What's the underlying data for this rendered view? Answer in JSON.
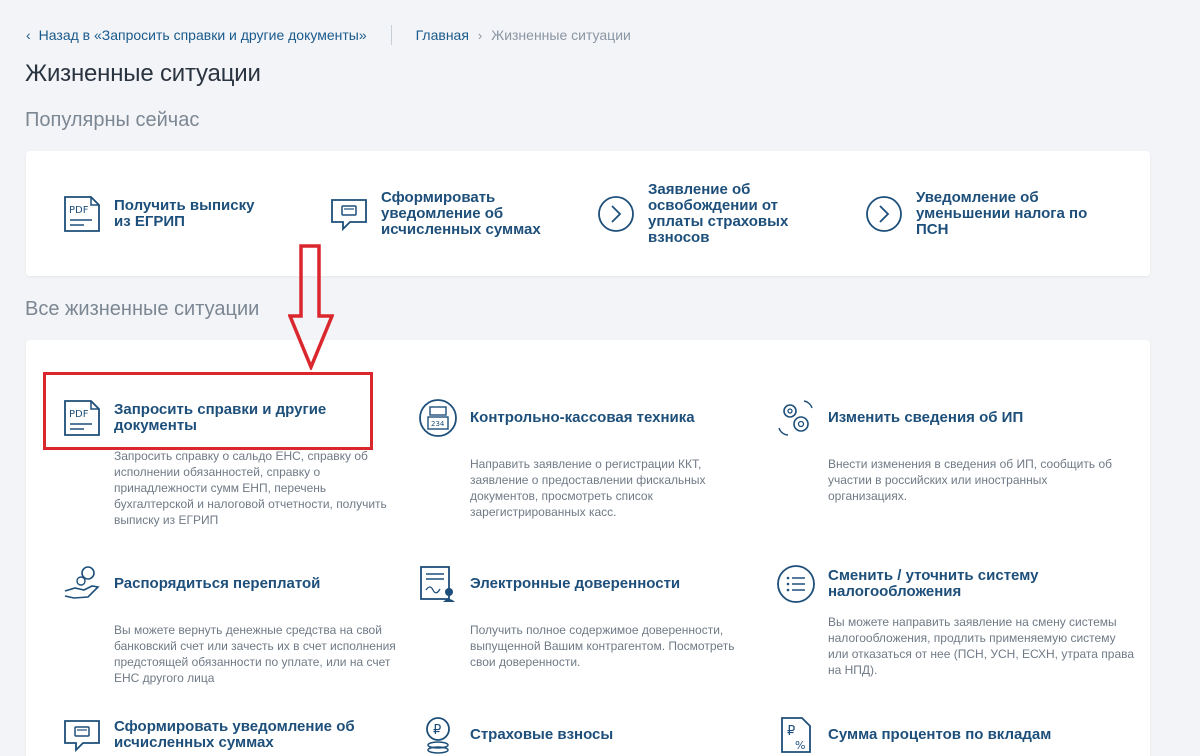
{
  "nav": {
    "back_label": "Назад в «Запросить справки и другие документы»",
    "breadcrumb_home": "Главная",
    "breadcrumb_current": "Жизненные ситуации"
  },
  "page": {
    "title": "Жизненные ситуации",
    "popular_title": "Популярны сейчас",
    "all_title": "Все жизненные ситуации"
  },
  "popular": [
    {
      "label": "Получить выписку из ЕГРИП",
      "icon": "pdf-document-icon"
    },
    {
      "label": "Сформировать уведомление об исчисленных суммах",
      "icon": "message-card-icon"
    },
    {
      "label": "Заявление об освобождении от уплаты страховых взносов",
      "icon": "chevron-circle-icon"
    },
    {
      "label": "Уведомление об уменьшении налога по ПСН",
      "icon": "chevron-circle-icon"
    }
  ],
  "situations": [
    {
      "label": "Запросить справки и другие документы",
      "icon": "pdf-document-icon",
      "desc": "Запросить справку о сальдо ЕНС, справку об исполнении обязанностей, справку о принадлежности сумм ЕНП, перечень бухгалтерской и налоговой отчетности, получить выписку из ЕГРИП"
    },
    {
      "label": "Контрольно-кассовая техника",
      "icon": "cash-register-icon",
      "desc": "Направить заявление о регистрации ККТ, заявление о предоставлении фискальных документов, просмотреть список зарегистрированных касс."
    },
    {
      "label": "Изменить сведения об ИП",
      "icon": "gears-icon",
      "desc": "Внести изменения в сведения об ИП, сообщить об участии в российских или иностранных организациях."
    },
    {
      "label": "Распорядиться переплатой",
      "icon": "hand-coins-icon",
      "desc": "Вы можете вернуть денежные средства на свой банковский счет или зачесть их в счет исполнения предстоящей обязанности по уплате, или на счет ЕНС другого лица"
    },
    {
      "label": "Электронные доверенности",
      "icon": "e-signature-document-icon",
      "desc": "Получить полное содержимое доверенности, выпущенной Вашим контрагентом. Посмотреть свои доверенности."
    },
    {
      "label": "Сменить / уточнить систему налогообложения",
      "icon": "list-circle-icon",
      "desc": "Вы можете направить заявление на смену системы налогообложения, продлить применяемую систему или отказаться от нее (ПСН, УСН, ЕСХН, утрата права на НПД)."
    },
    {
      "label": "Сформировать уведомление об исчисленных суммах",
      "icon": "message-card-icon",
      "desc": ""
    },
    {
      "label": "Страховые взносы",
      "icon": "ruble-coins-icon",
      "desc": ""
    },
    {
      "label": "Сумма процентов по вкладам",
      "icon": "ruble-percent-document-icon",
      "desc": ""
    }
  ],
  "colors": {
    "accent": "#1d4f7a",
    "annotation": "#d9272d",
    "muted": "#7c8794"
  }
}
